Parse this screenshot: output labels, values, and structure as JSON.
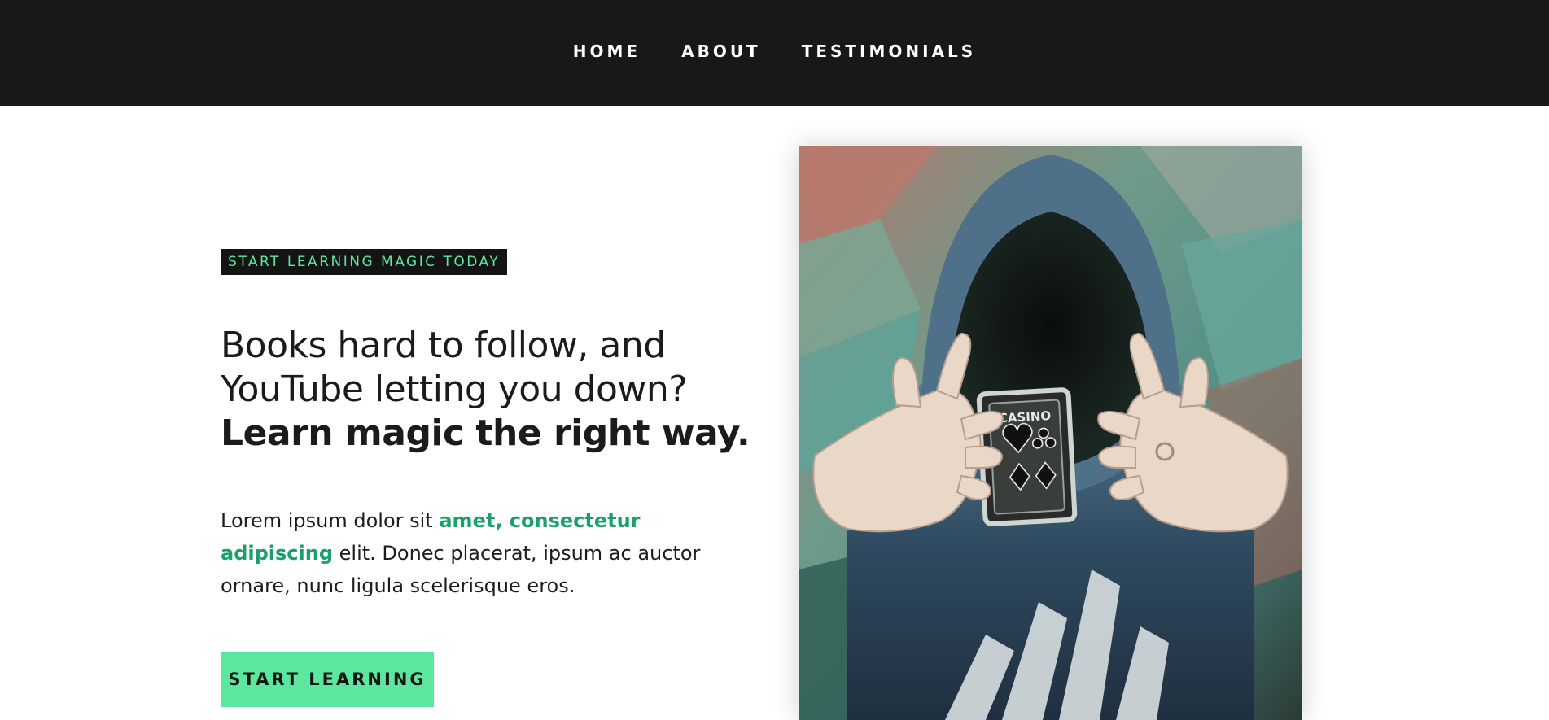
{
  "nav": {
    "items": [
      {
        "label": "HOME"
      },
      {
        "label": "ABOUT"
      },
      {
        "label": "TESTIMONIALS"
      }
    ]
  },
  "hero": {
    "eyebrow": "START LEARNING MAGIC TODAY",
    "headline_regular": "Books hard to follow, and YouTube letting you down? ",
    "headline_bold": "Learn magic the right way.",
    "intro_pre": "Lorem ipsum dolor sit ",
    "intro_highlight": "amet, consectetur adipiscing",
    "intro_post": " elit. Donec placerat, ipsum ac auctor ornare, nunc ligula scelerisque eros.",
    "cta_label": "START LEARNING",
    "image": {
      "card_text": "CASINO"
    }
  },
  "colors": {
    "nav_background": "#181818",
    "accent_green": "#5be7a0",
    "link_green": "#1aa06a",
    "text": "#1b1b1b"
  }
}
